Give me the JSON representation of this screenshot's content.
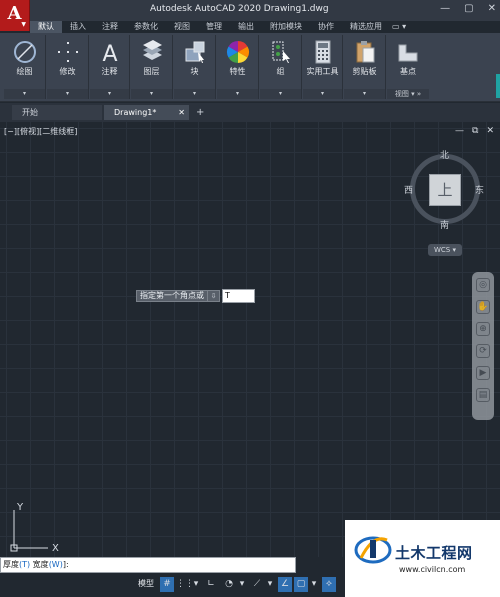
{
  "window": {
    "title": "Autodesk AutoCAD 2020    Drawing1.dwg",
    "app_logo": "A",
    "controls": [
      "—",
      "▢",
      "✕"
    ]
  },
  "ribbon_tabs": [
    "默认",
    "插入",
    "注释",
    "参数化",
    "视图",
    "管理",
    "输出",
    "附加模块",
    "协作",
    "精选应用"
  ],
  "ribbon_extra": "▭ ▾",
  "ribbon_groups": [
    {
      "label": "绘图",
      "icon": "draw-circle-icon",
      "foot": "▾"
    },
    {
      "label": "修改",
      "icon": "move-icon",
      "foot": "▾"
    },
    {
      "label": "注释",
      "icon": "text-a-icon",
      "foot": "▾"
    },
    {
      "label": "图层",
      "icon": "layers-icon",
      "foot": "▾"
    },
    {
      "label": "块",
      "icon": "block-icon",
      "foot": "▾"
    },
    {
      "label": "特性",
      "icon": "color-wheel-icon",
      "foot": "▾"
    },
    {
      "label": "组",
      "icon": "group-icon",
      "foot": "▾"
    },
    {
      "label": "实用工具",
      "icon": "calculator-icon",
      "foot": "▾"
    },
    {
      "label": "剪贴板",
      "icon": "clipboard-icon",
      "foot": "▾"
    },
    {
      "label": "基点",
      "icon": "basepoint-icon",
      "foot": "视图 ▾ »"
    }
  ],
  "doc_tabs": {
    "start": "开始",
    "drawing": "Drawing1*",
    "close": "✕",
    "add": "+"
  },
  "viewport": {
    "label": "[−][俯视][二维线框]",
    "controls": [
      "—",
      "⧉",
      "✕"
    ],
    "viewcube": {
      "north": "北",
      "south": "南",
      "west": "西",
      "east": "东",
      "face": "上"
    },
    "wcs": "WCS ▾"
  },
  "prompt": {
    "text": "指定第一个角点或",
    "arrow": "⇩",
    "input": "T"
  },
  "ucs": {
    "y": "Y",
    "x": "X"
  },
  "command_line": {
    "pre": "厚度",
    "opt1": "(T)",
    "mid": " 宽度",
    "opt2": "(W)",
    "post": "]:"
  },
  "status": {
    "model": "模型"
  },
  "watermark": {
    "title": "土木工程网",
    "url": "www.civilcn.com"
  },
  "colors": {
    "accent": "#1fa3a3",
    "logo_red": "#b31b1b",
    "status_on": "#2f6fb1"
  }
}
